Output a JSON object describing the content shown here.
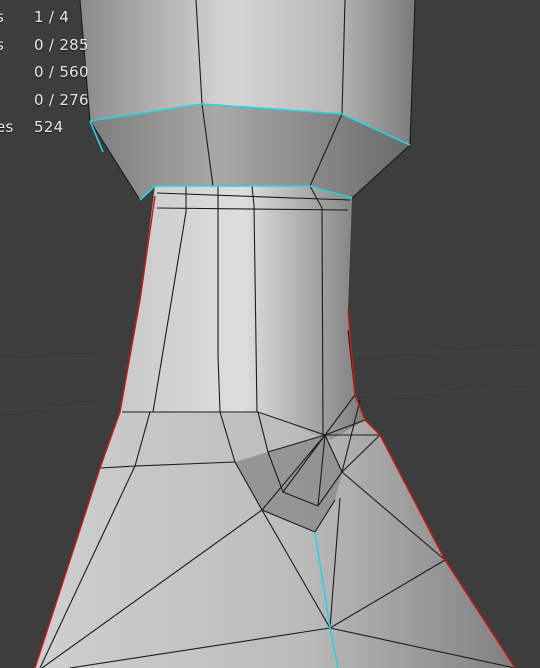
{
  "viewport": {
    "background": "#3d3d3d",
    "wire_color": "#1b1b1b",
    "selected_edge_color": "#27d3dd",
    "seam_edge_color": "#d01818"
  },
  "statistics": [
    {
      "label": "s",
      "value": "1 / 4"
    },
    {
      "label": "s",
      "value": "0 / 285"
    },
    {
      "label": "",
      "value": "0 / 560"
    },
    {
      "label": "",
      "value": "0 / 276"
    },
    {
      "label": "es",
      "value": "524"
    }
  ]
}
